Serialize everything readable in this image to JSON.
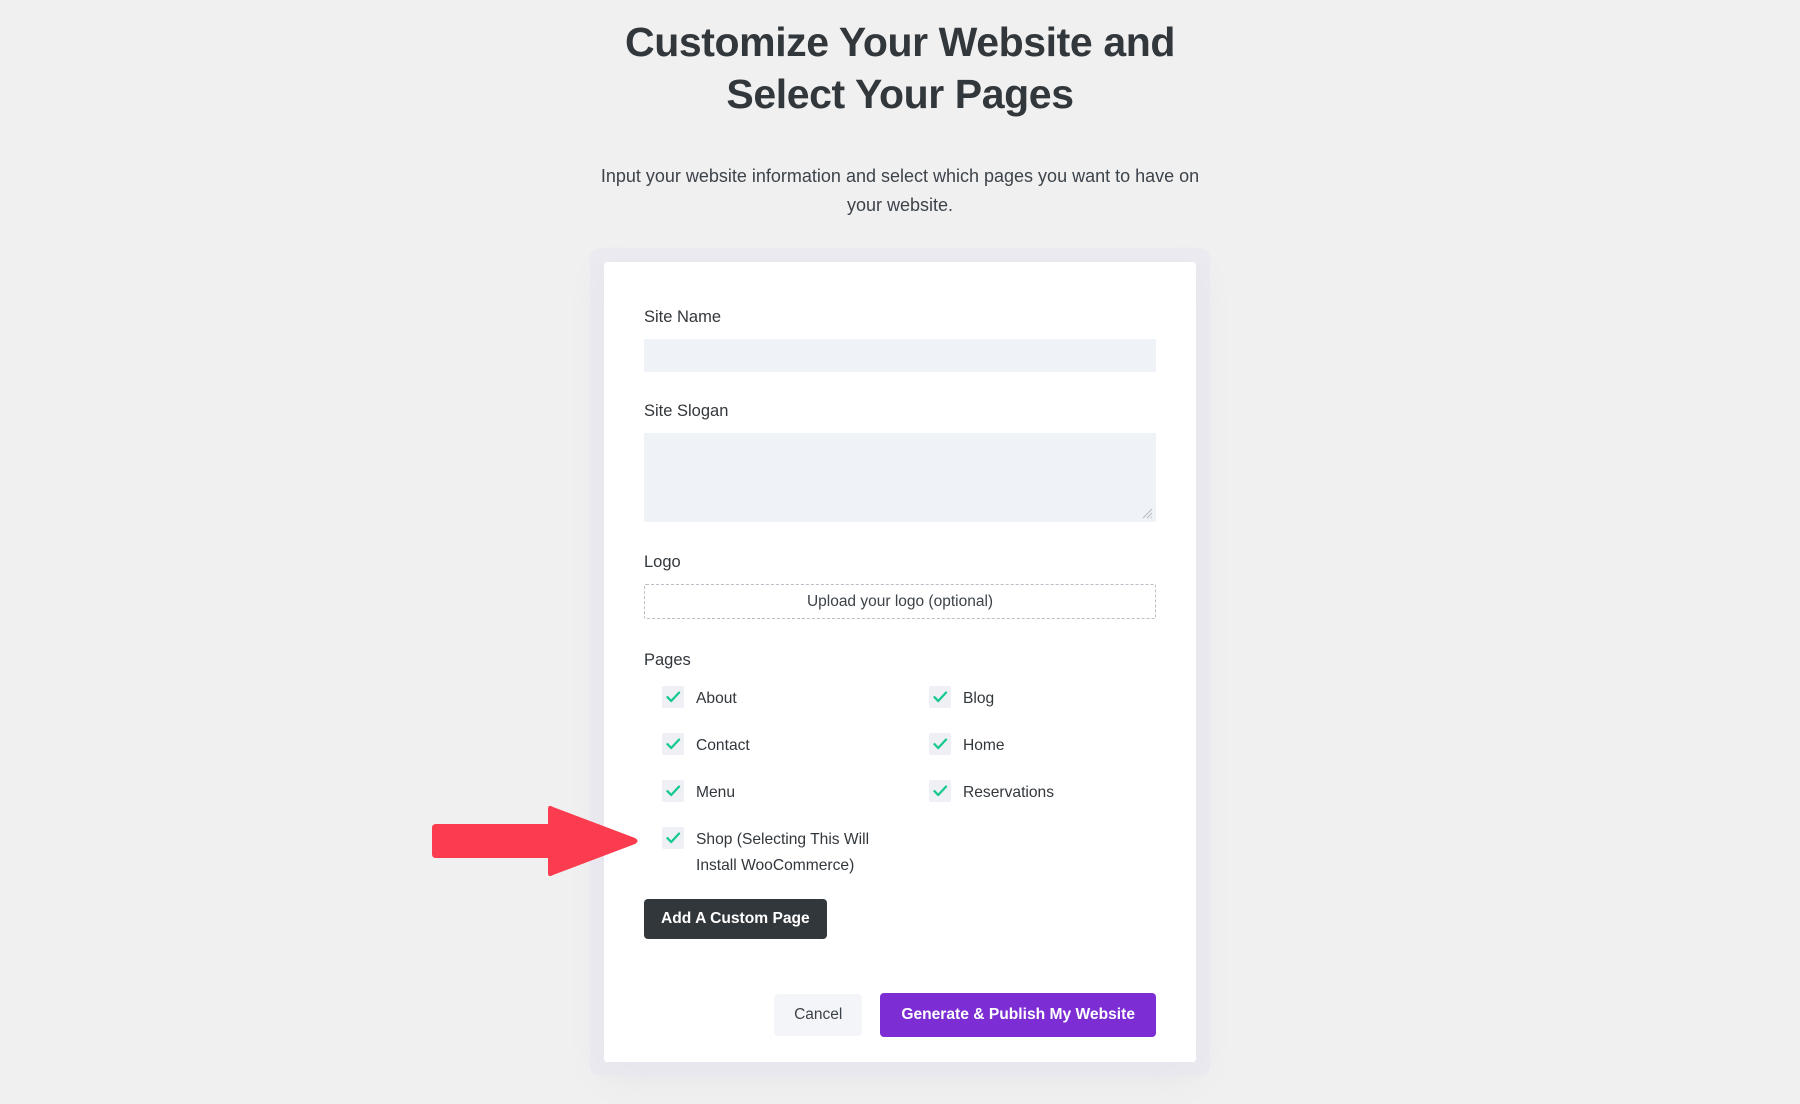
{
  "header": {
    "title": "Customize Your Website and Select Your Pages",
    "subtitle": "Input your website information and select which pages you want to have on your website."
  },
  "form": {
    "site_name": {
      "label": "Site Name",
      "value": "",
      "placeholder": ""
    },
    "site_slogan": {
      "label": "Site Slogan",
      "value": "",
      "placeholder": ""
    },
    "logo": {
      "label": "Logo",
      "upload_text": "Upload your logo (optional)"
    },
    "pages": {
      "label": "Pages",
      "items": [
        {
          "label": "About",
          "checked": true
        },
        {
          "label": "Blog",
          "checked": true
        },
        {
          "label": "Contact",
          "checked": true
        },
        {
          "label": "Home",
          "checked": true
        },
        {
          "label": "Menu",
          "checked": true
        },
        {
          "label": "Reservations",
          "checked": true
        },
        {
          "label": "Shop (Selecting This Will Install WooCommerce)",
          "checked": true
        }
      ]
    },
    "add_custom_page_label": "Add A Custom Page"
  },
  "actions": {
    "cancel_label": "Cancel",
    "publish_label": "Generate & Publish My Website"
  },
  "colors": {
    "page_background": "#f0f0f0",
    "card_background": "#ffffff",
    "input_background": "#eff2f6",
    "checkbox_background": "#eef0f6",
    "checkmark": "#16c98d",
    "primary_button": "#7c2ed4",
    "dark_button": "#32373c",
    "annotation_arrow": "#fb3b4e",
    "text": "#32373c"
  },
  "annotation": {
    "arrow_icon": "right-arrow-icon",
    "points_at": "Shop (Selecting This Will Install WooCommerce)"
  }
}
